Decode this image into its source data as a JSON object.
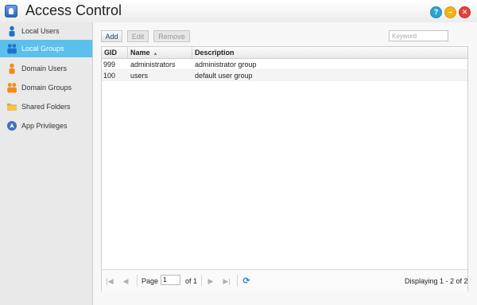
{
  "window": {
    "title": "Access Control",
    "help_label": "?",
    "minimize_label": "–",
    "close_label": "✕"
  },
  "sidebar": {
    "items": [
      {
        "label": "Local Users",
        "icon": "local-user-icon",
        "active": false
      },
      {
        "label": "Local Groups",
        "icon": "local-group-icon",
        "active": true
      },
      {
        "label": "Domain Users",
        "icon": "domain-user-icon",
        "active": false
      },
      {
        "label": "Domain Groups",
        "icon": "domain-group-icon",
        "active": false
      },
      {
        "label": "Shared Folders",
        "icon": "folder-icon",
        "active": false
      },
      {
        "label": "App Privileges",
        "icon": "app-privilege-icon",
        "active": false
      }
    ]
  },
  "toolbar": {
    "add_label": "Add",
    "edit_label": "Edit",
    "remove_label": "Remove",
    "search_placeholder": "Keyword",
    "search_value": ""
  },
  "table": {
    "columns": [
      "GID",
      "Name",
      "Description"
    ],
    "rows": [
      {
        "gid": "999",
        "name": "administrators",
        "description": "administrator group"
      },
      {
        "gid": "100",
        "name": "users",
        "description": "default user group"
      }
    ]
  },
  "pager": {
    "page_label": "Page",
    "page_value": "1",
    "of_label": "of 1",
    "display_text": "Displaying 1 - 2 of 2"
  },
  "colors": {
    "accent": "#5bc0eb",
    "help": "#2ca3d6",
    "minimize": "#f3b215",
    "close": "#e0443a",
    "user_icon_blue": "#1e73c8",
    "user_icon_orange": "#f28a1a"
  }
}
